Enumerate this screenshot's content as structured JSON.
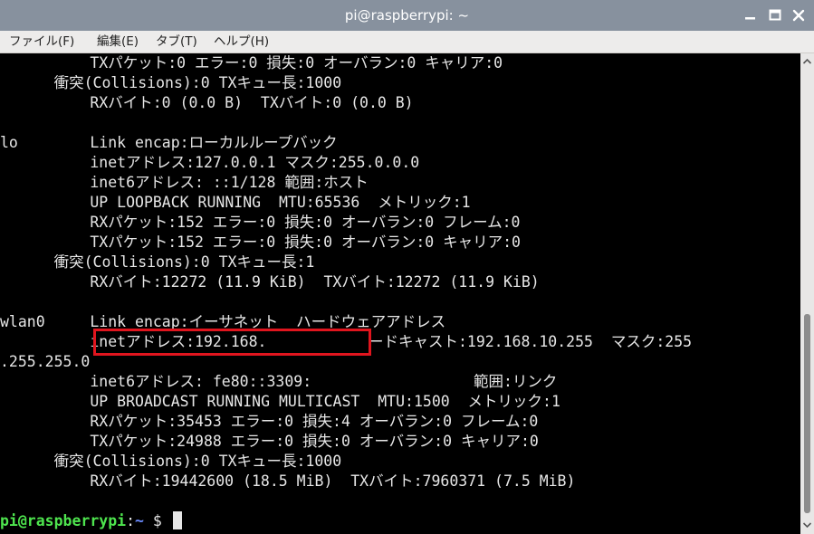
{
  "window": {
    "title": "pi@raspberrypi: ~"
  },
  "menu": {
    "file": "ファイル(F)",
    "edit": "編集(E)",
    "tabs": "タブ(T)",
    "help": "ヘルプ(H)"
  },
  "icons": {
    "minimize": "minimize-icon",
    "maximize": "maximize-icon",
    "close": "close-icon",
    "scroll_up": "chevron-up-icon",
    "scroll_down": "chevron-down-icon"
  },
  "colors": {
    "titlebar": "#87919e",
    "terminal_bg": "#000000",
    "terminal_fg": "#e6e6e6",
    "prompt_user": "#4ee44e",
    "prompt_path": "#6b8cff",
    "highlight": "#e0151e"
  },
  "terminal": {
    "lines": [
      "          TXパケット:0 エラー:0 損失:0 オーバラン:0 キャリア:0",
      "      衝突(Collisions):0 TXキュー長:1000",
      "          RXバイト:0 (0.0 B)  TXバイト:0 (0.0 B)",
      "",
      "lo        Link encap:ローカルループバック",
      "          inetアドレス:127.0.0.1 マスク:255.0.0.0",
      "          inet6アドレス: ::1/128 範囲:ホスト",
      "          UP LOOPBACK RUNNING  MTU:65536  メトリック:1",
      "          RXパケット:152 エラー:0 損失:0 オーバラン:0 フレーム:0",
      "          TXパケット:152 エラー:0 損失:0 オーバラン:0 キャリア:0",
      "      衝突(Collisions):0 TXキュー長:1",
      "          RXバイト:12272 (11.9 KiB)  TXバイト:12272 (11.9 KiB)",
      "",
      "wlan0     Link encap:イーサネット  ハードウェアアドレス",
      "          inetアドレス:192.168.        ブロードキャスト:192.168.10.255  マスク:255",
      ".255.255.0",
      "          inet6アドレス: fe80::3309:                  範囲:リンク",
      "          UP BROADCAST RUNNING MULTICAST  MTU:1500  メトリック:1",
      "          RXパケット:35453 エラー:0 損失:4 オーバラン:0 フレーム:0",
      "          TXパケット:24988 エラー:0 損失:0 オーバラン:0 キャリア:0",
      "      衝突(Collisions):0 TXキュー長:1000",
      "          RXバイト:19442600 (18.5 MiB)  TXバイト:7960371 (7.5 MiB)",
      ""
    ],
    "prompt": {
      "user": "pi@raspberrypi",
      "separator": ":",
      "path": "~",
      "symbol": " $ "
    }
  }
}
